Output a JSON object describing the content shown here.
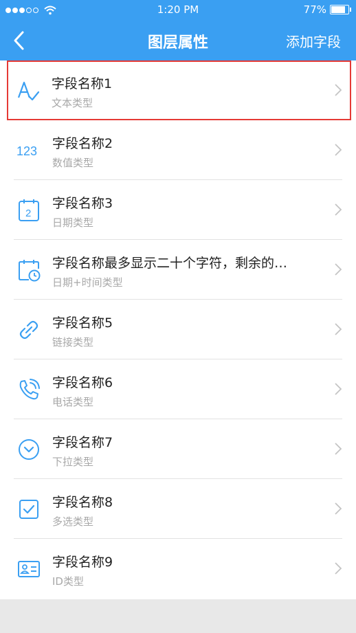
{
  "status": {
    "time": "1:20 PM",
    "battery": "77%"
  },
  "nav": {
    "title": "图层属性",
    "add_label": "添加字段"
  },
  "fields": [
    {
      "name": "字段名称1",
      "type": "文本类型",
      "icon": "text-type-icon"
    },
    {
      "name": "字段名称2",
      "type": "数值类型",
      "icon": "number-type-icon",
      "icon_text": "123"
    },
    {
      "name": "字段名称3",
      "type": "日期类型",
      "icon": "calendar-icon",
      "icon_text": "2"
    },
    {
      "name": "字段名称最多显示二十个字符，剩余的…",
      "type": "日期+时间类型",
      "icon": "calendar-clock-icon"
    },
    {
      "name": "字段名称5",
      "type": "链接类型",
      "icon": "link-icon"
    },
    {
      "name": "字段名称6",
      "type": "电话类型",
      "icon": "phone-icon"
    },
    {
      "name": "字段名称7",
      "type": "下拉类型",
      "icon": "dropdown-icon"
    },
    {
      "name": "字段名称8",
      "type": "多选类型",
      "icon": "checkbox-icon"
    },
    {
      "name": "字段名称9",
      "type": "ID类型",
      "icon": "id-card-icon"
    }
  ],
  "colors": {
    "accent": "#3a9ff2",
    "highlight": "#e53935"
  }
}
